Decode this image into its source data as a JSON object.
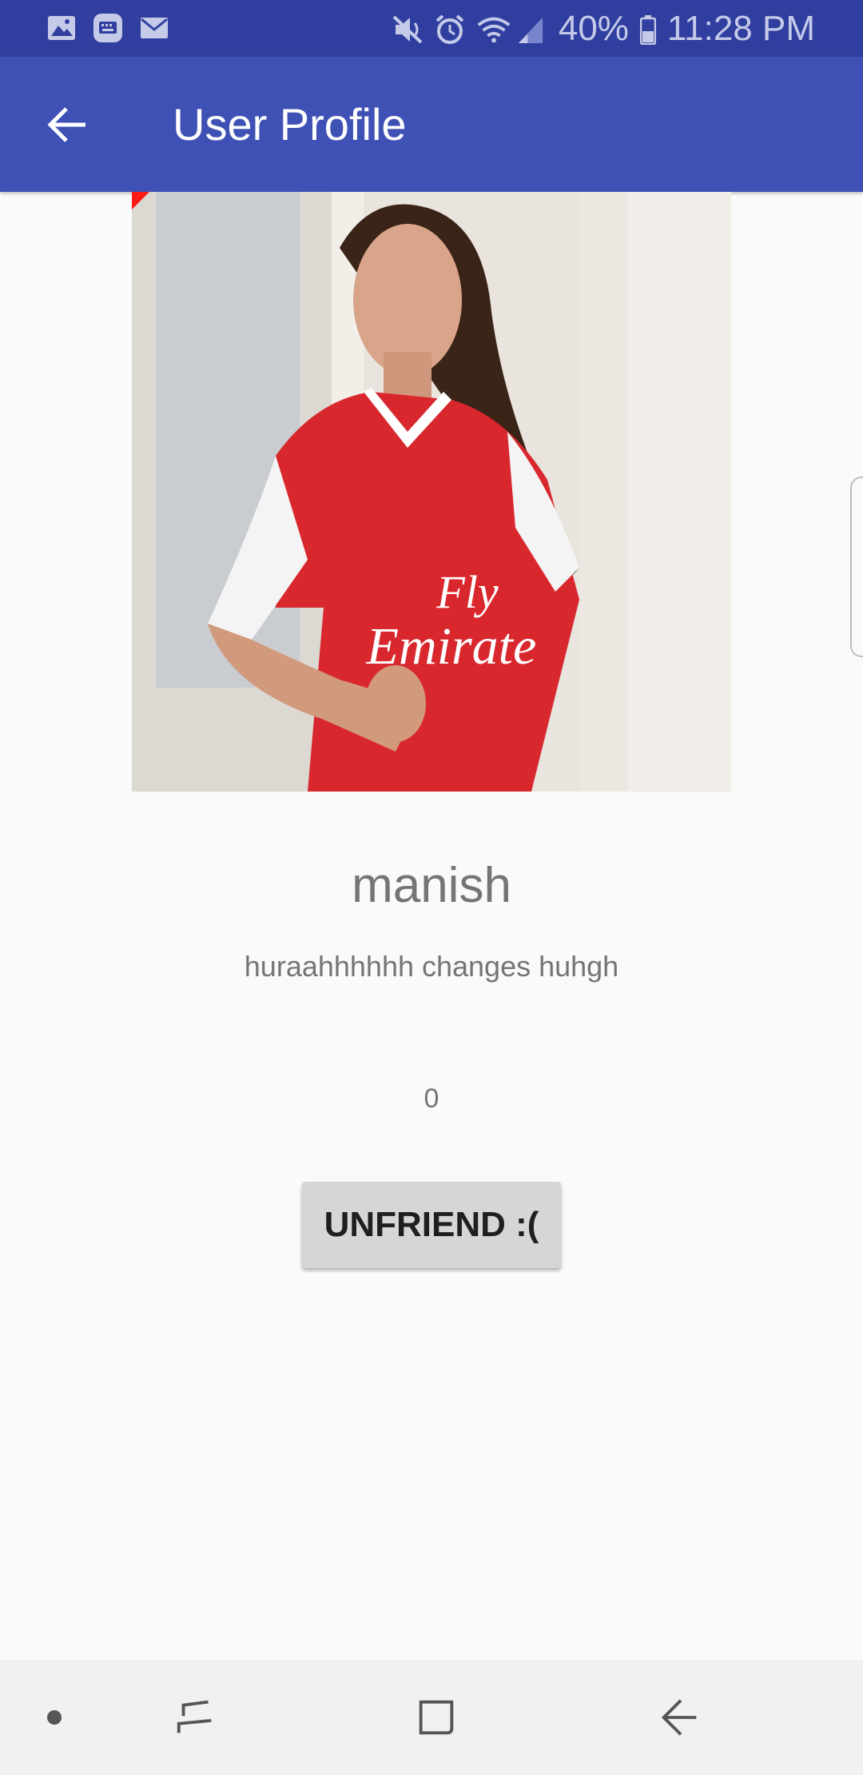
{
  "status_bar": {
    "icons_left": [
      "gallery-icon",
      "keyboard-icon",
      "mail-icon"
    ],
    "icons_right": [
      "mute-icon",
      "alarm-icon",
      "wifi-icon",
      "signal-icon"
    ],
    "battery": "40%",
    "time": "11:28 PM"
  },
  "app_bar": {
    "title": "User Profile",
    "back_icon": "arrow-back-icon"
  },
  "profile": {
    "photo_alt": "profile-photo",
    "name": "manish",
    "status": "huraahhhhhh changes huhgh",
    "count": "0",
    "unfriend_label": "UNFRIEND :("
  },
  "nav_bar": {
    "items": [
      "dot-icon",
      "recent-apps-icon",
      "home-icon",
      "back-icon"
    ]
  },
  "colors": {
    "status_bar": "#303f9f",
    "app_bar": "#3f51b5",
    "background": "#fafafa",
    "button": "#d6d6d6"
  }
}
